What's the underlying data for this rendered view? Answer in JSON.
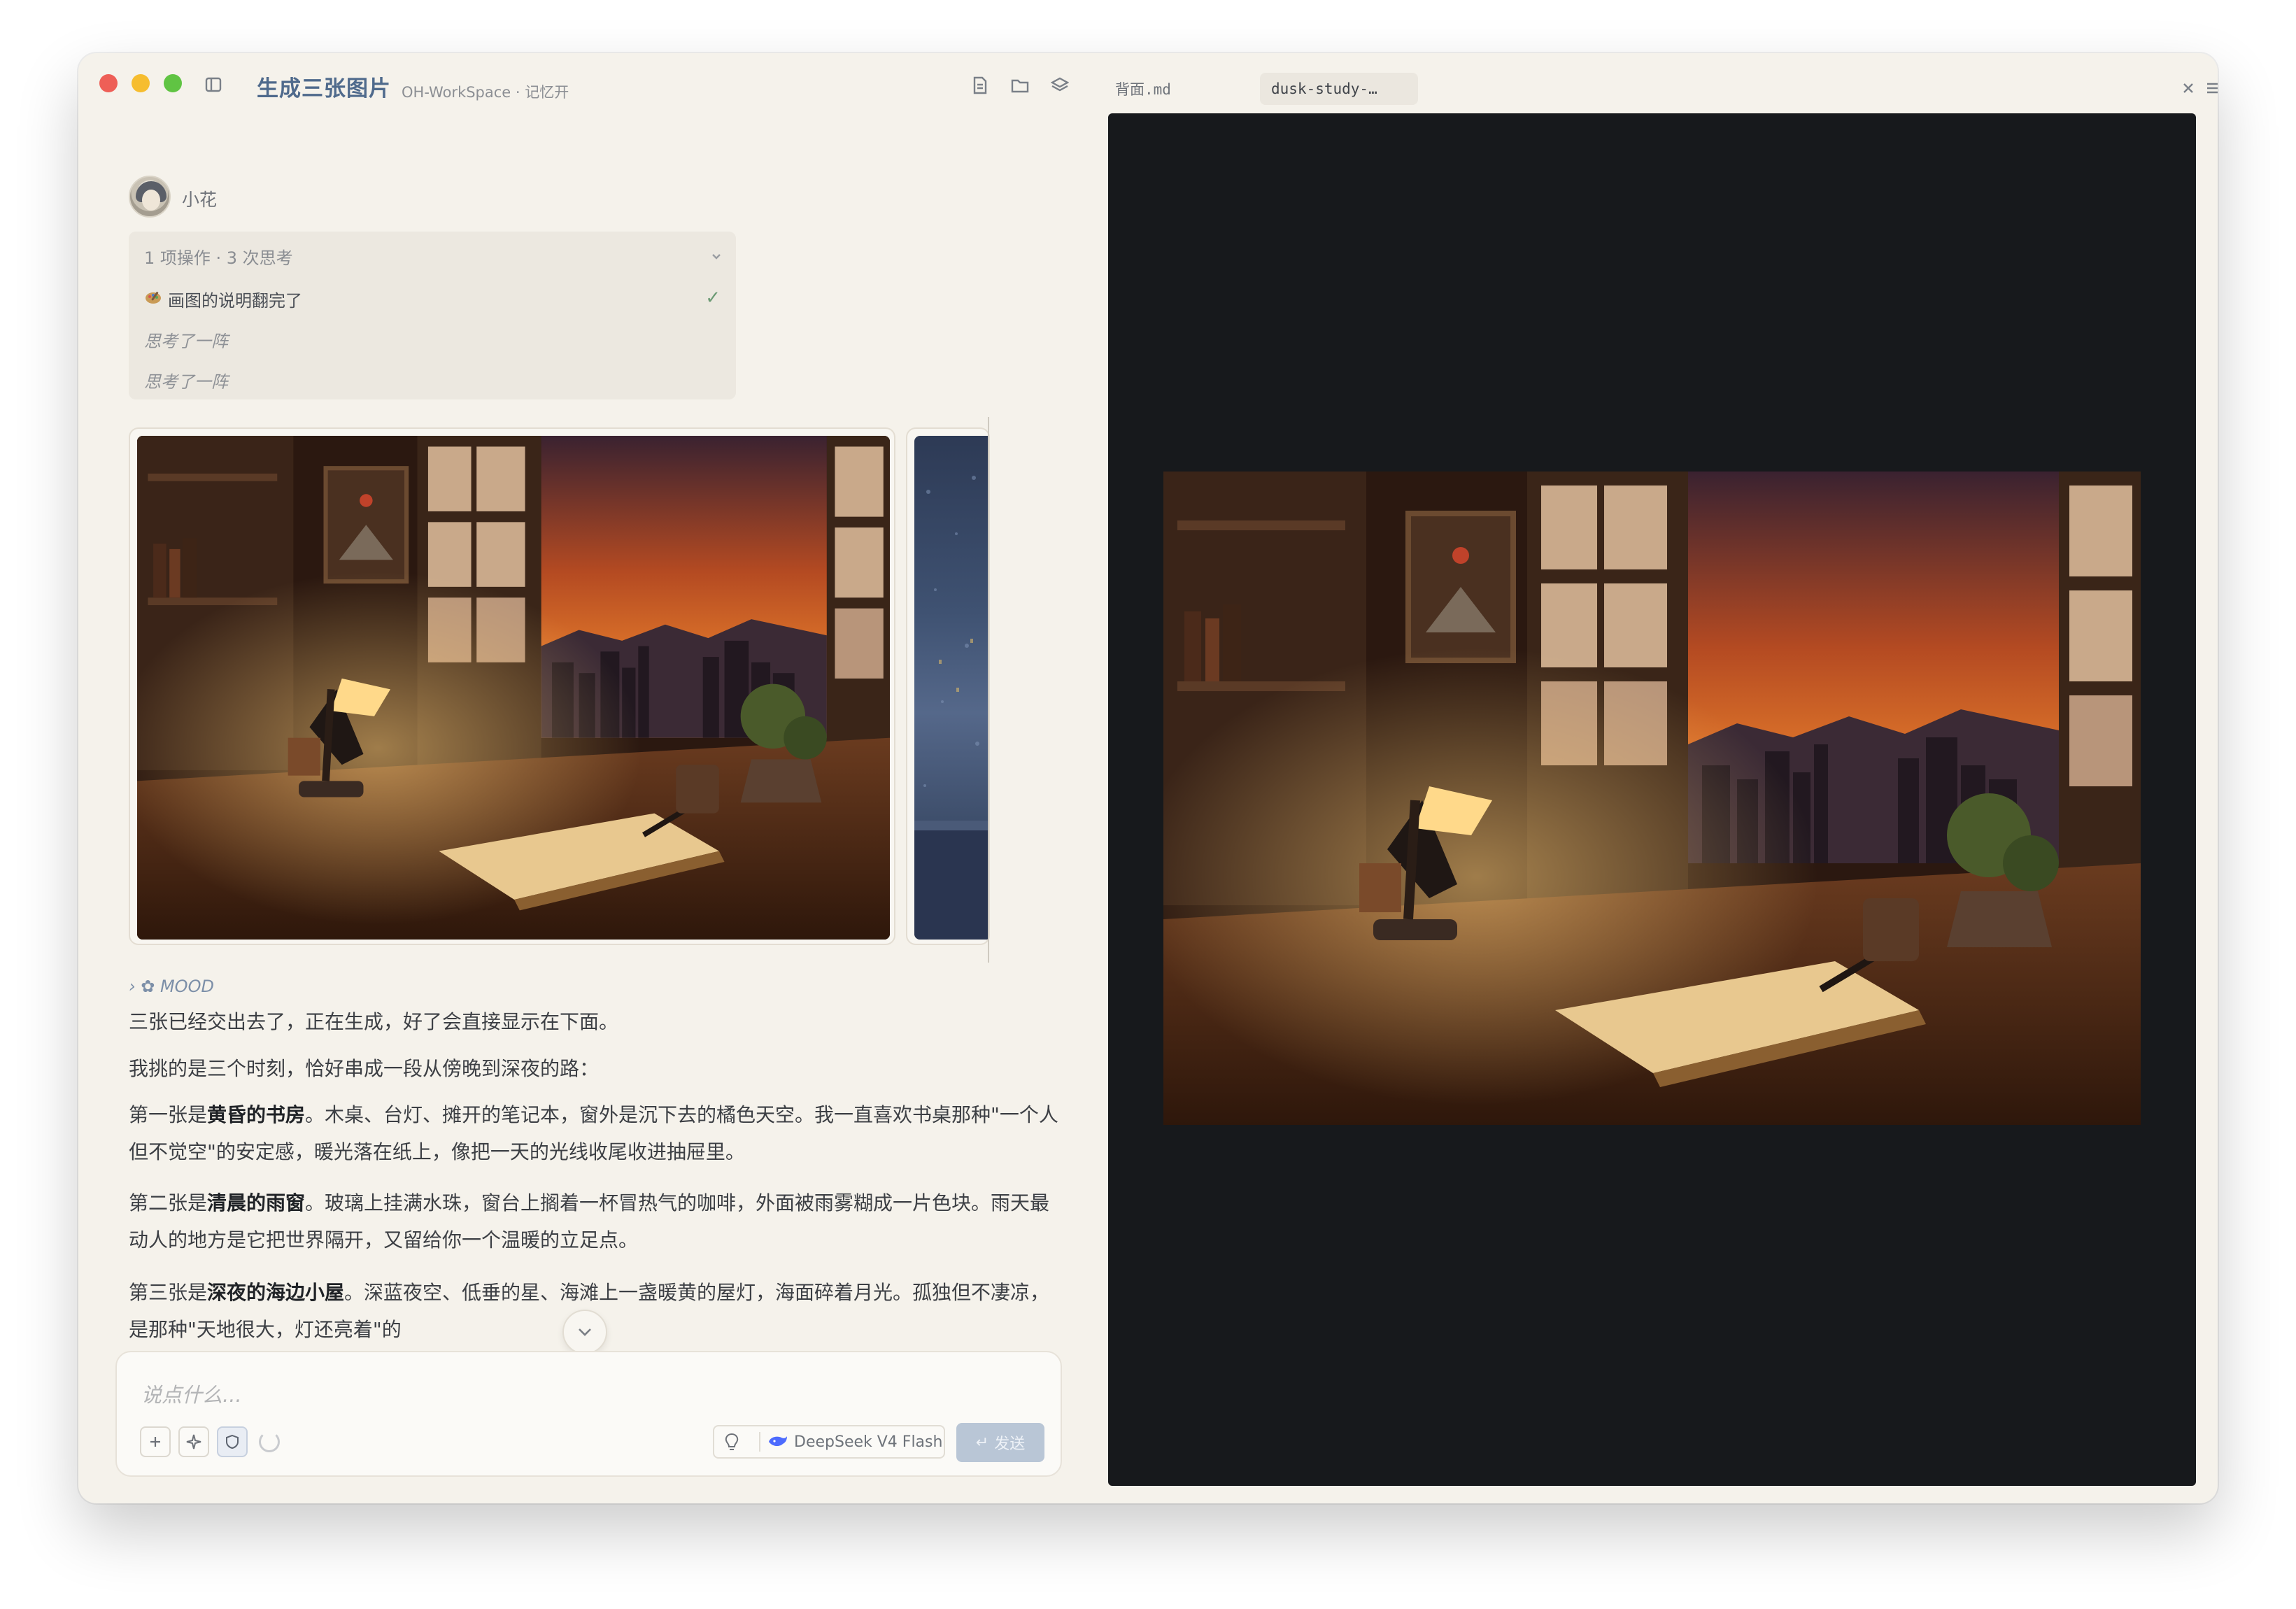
{
  "window": {
    "title": "生成三张图片",
    "subtitle": "OH-WorkSpace · 记忆开"
  },
  "message": {
    "author": "小花",
    "operations": {
      "summary": "1 项操作 · 3 次思考",
      "items": [
        {
          "label": "画图的说明翻完了",
          "status": "done"
        }
      ],
      "thoughts": [
        "思考了一阵",
        "思考了一阵"
      ]
    },
    "mood_label": "✿ MOOD",
    "paragraphs": {
      "p1": "三张已经交出去了，正在生成，好了会直接显示在下面。",
      "p2": "我挑的是三个时刻，恰好串成一段从傍晚到深夜的路：",
      "p3": {
        "prefix": "第一张是",
        "bold": "黄昏的书房",
        "suffix": "。木桌、台灯、摊开的笔记本，窗外是沉下去的橘色天空。我一直喜欢书桌那种\"一个人但不觉空\"的安定感，暖光落在纸上，像把一天的光线收尾收进抽屉里。"
      },
      "p4": {
        "prefix": "第二张是",
        "bold": "清晨的雨窗",
        "suffix": "。玻璃上挂满水珠，窗台上搁着一杯冒热气的咖啡，外面被雨雾糊成一片色块。雨天最动人的地方是它把世界隔开，又留给你一个温暖的立足点。"
      },
      "p5": {
        "prefix": "第三张是",
        "bold": "深夜的海边小屋",
        "suffix": "。深蓝夜空、低垂的星、海滩上一盏暖黄的屋灯，海面碎着月光。孤独但不凄凉，是那种\"天地很大，灯还亮着\"的"
      }
    }
  },
  "composer": {
    "placeholder": "说点什么...",
    "model": "DeepSeek V4 Flash",
    "send_label": "发送"
  },
  "right_pane": {
    "tabs": [
      {
        "label": "背面.md",
        "active": false
      },
      {
        "label": "dusk-study-…",
        "active": true
      }
    ]
  },
  "icons": {
    "sidebar_toggle": "sidebar-icon",
    "document": "document-icon",
    "folder": "folder-icon",
    "layers": "layers-icon",
    "menu": "menu-icon",
    "close": "close-icon"
  },
  "colors": {
    "accent": "#4f6a8c",
    "window_bg": "#f5f2eb",
    "viewer_bg": "#17191c",
    "check": "#6b9a74"
  }
}
